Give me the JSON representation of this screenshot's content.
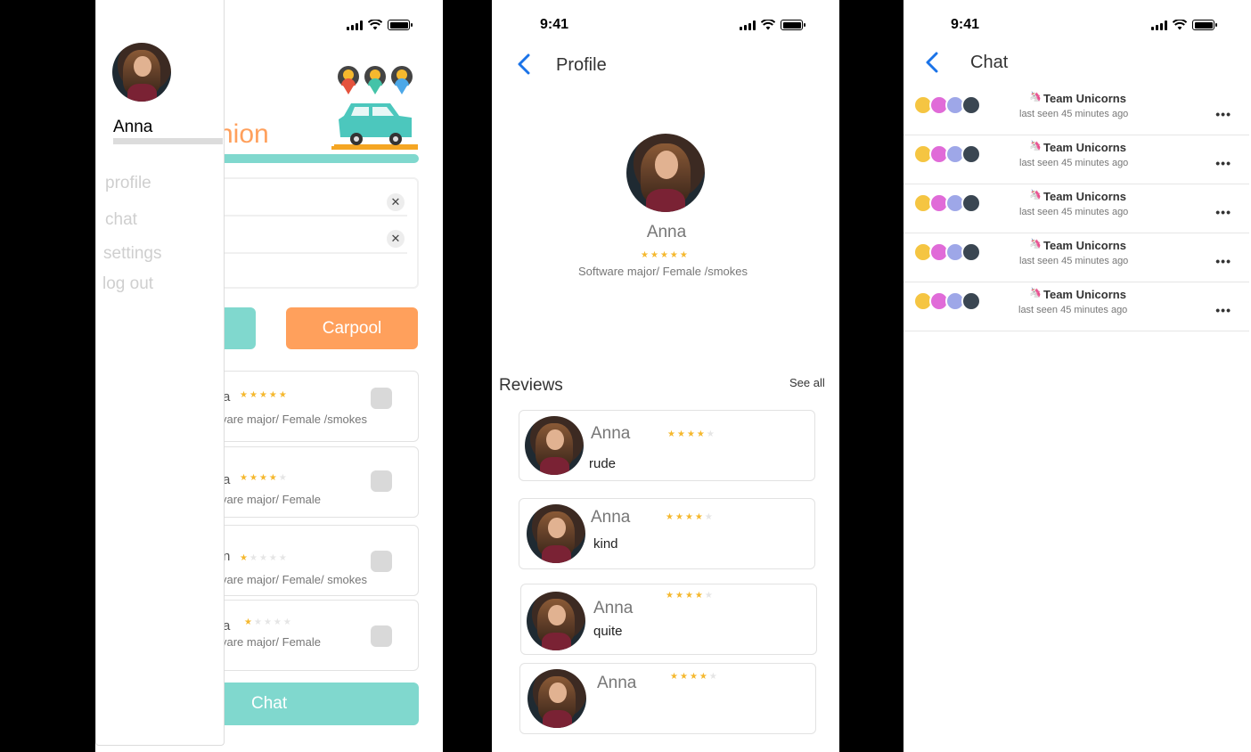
{
  "colors": {
    "teal": "#80D8CE",
    "orange": "#FFA05C",
    "blue": "#1A73E8",
    "star": "#F5B82E"
  },
  "status": {
    "time": "9:41"
  },
  "screen1": {
    "drawer": {
      "user_name": "Anna",
      "menu": [
        "profile",
        "chat",
        "settings",
        "log out"
      ]
    },
    "brand_partial": "nion",
    "carpool_label": "Carpool",
    "chat_label": "Chat",
    "riders": [
      {
        "name_partial": "a",
        "rating": 5,
        "desc_partial": "vare major/ Female /smokes"
      },
      {
        "name_partial": "a",
        "rating": 3.5,
        "desc_partial": "vare major/ Female"
      },
      {
        "name_partial": "n",
        "rating": 1,
        "desc_partial": "vare major/ Female/ smokes"
      },
      {
        "name_partial": "a",
        "rating": 1,
        "desc_partial": "vare major/ Female"
      }
    ]
  },
  "screen2": {
    "title": "Profile",
    "name": "Anna",
    "rating": 5,
    "desc": "Software major/ Female /smokes",
    "reviews_title": "Reviews",
    "see_all": "See all",
    "reviews": [
      {
        "name": "Anna",
        "rating": 3.5,
        "text": "rude"
      },
      {
        "name": "Anna",
        "rating": 3.5,
        "text": "kind"
      },
      {
        "name": "Anna",
        "rating": 3.5,
        "text": "quite"
      },
      {
        "name": "Anna",
        "rating": 3.5,
        "text": ""
      }
    ]
  },
  "screen3": {
    "title": "Chat",
    "rows": [
      {
        "group": "Team Unicorns",
        "emoji": "🦄",
        "status": "last seen 45 minutes ago"
      },
      {
        "group": "Team Unicorns",
        "emoji": "🦄",
        "status": "last seen 45 minutes ago"
      },
      {
        "group": "Team Unicorns",
        "emoji": "🦄",
        "status": "last seen 45 minutes ago"
      },
      {
        "group": "Team Unicorns",
        "emoji": "🦄",
        "status": "last seen 45 minutes ago"
      },
      {
        "group": "Team Unicorns",
        "emoji": "🦄",
        "status": "last seen 45 minutes ago"
      }
    ]
  }
}
